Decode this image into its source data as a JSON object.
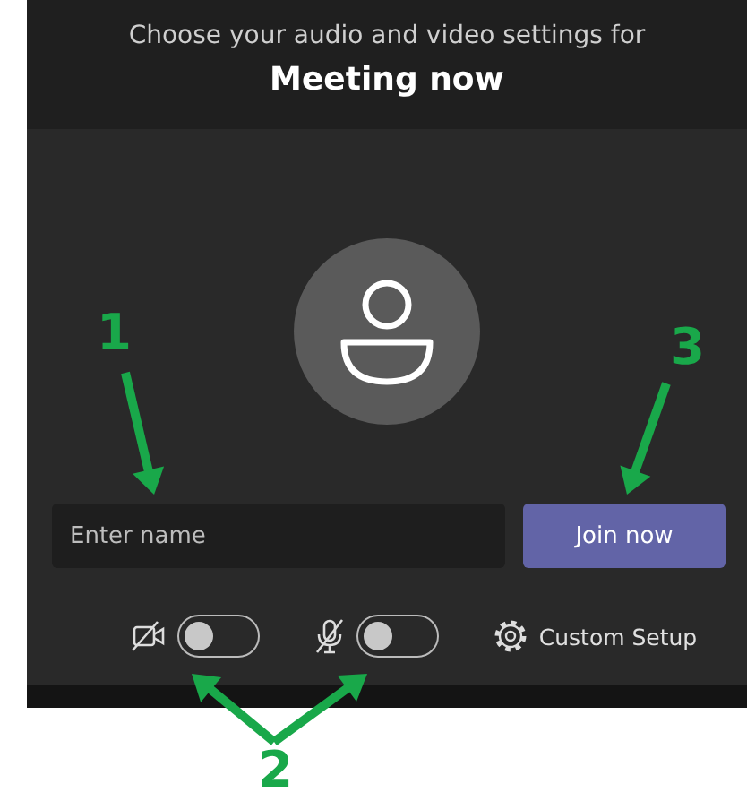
{
  "header": {
    "subtitle": "Choose your audio and video settings for",
    "title": "Meeting now"
  },
  "name_field": {
    "placeholder": "Enter name"
  },
  "join_button": {
    "label": "Join now"
  },
  "toggles": [
    {
      "kind": "camera",
      "on": false
    },
    {
      "kind": "microphone",
      "on": false
    }
  ],
  "custom_setup": {
    "label": "Custom Setup"
  },
  "annotations": [
    {
      "label": "1"
    },
    {
      "label": "2"
    },
    {
      "label": "3"
    }
  ]
}
